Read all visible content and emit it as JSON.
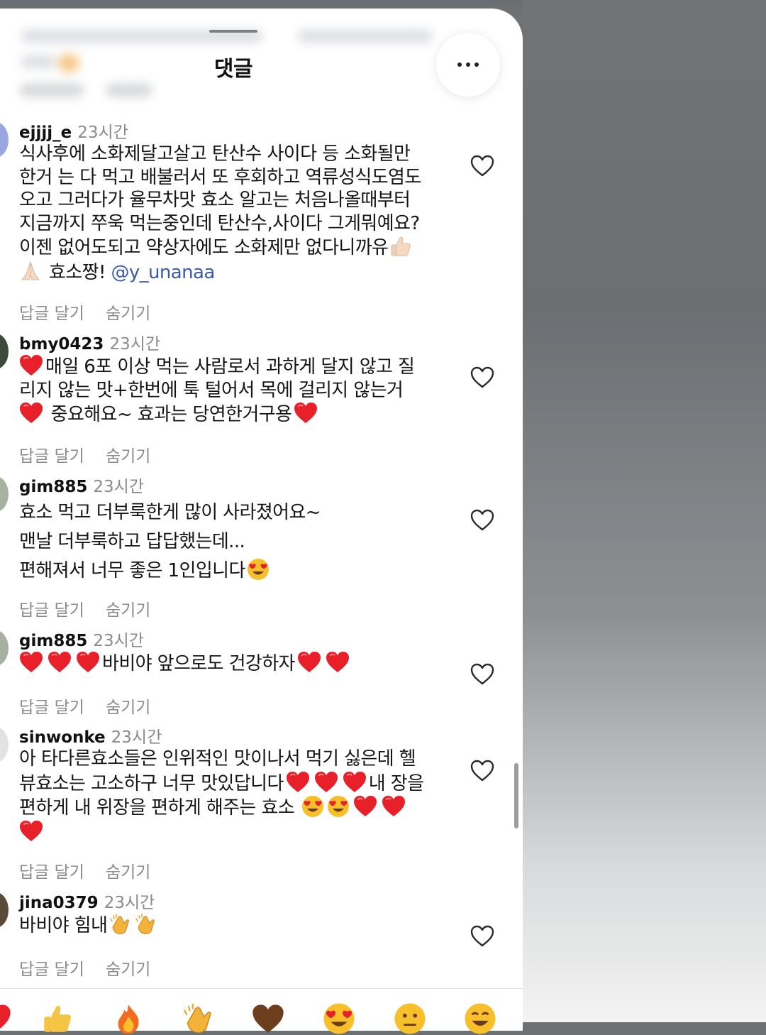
{
  "sheet": {
    "title": "댓글",
    "more_label": "더보기"
  },
  "comments": [
    {
      "user": "ejjjj_e",
      "time": "23시간",
      "lines": [
        "식사후에 소화제달고살고 탄산수 사이다 등 소화될만",
        "한거 는 다 먹고 배불러서 또 후회하고 역류성식도염도",
        "오고 그러다가 율무차맛 효소 알고는 처음나올때부터",
        "지금까지 쭈욱 먹는중인데 탄산수,사이다 그게뭐예요?",
        "이젠 없어도되고 약상자에도 소화제만 없다니까유",
        "효소짱! "
      ],
      "mention": "@y_unanaa",
      "reply_label": "답글 달기",
      "hide_label": "숨기기"
    },
    {
      "user": "bmy0423",
      "time": "23시간",
      "lines": [
        "매일 6포 이상 먹는 사람로서 과하게 달지 않고 질",
        "리지 않는 맛+한번에 툭 털어서 목에 걸리지 않는거",
        " 중요해요~ 효과는 당연한거구용"
      ],
      "reply_label": "답글 달기",
      "hide_label": "숨기기"
    },
    {
      "user": "gim885",
      "time": "23시간",
      "lines": [
        "효소 먹고 더부룩한게 많이 사라졌어요~",
        "맨날 더부룩하고 답답했는데...",
        "편해져서 너무 좋은 1인입니다"
      ],
      "reply_label": "답글 달기",
      "hide_label": "숨기기"
    },
    {
      "user": "gim885",
      "time": "23시간",
      "lines": [
        "바비야 앞으로도 건강하자"
      ],
      "reply_label": "답글 달기",
      "hide_label": "숨기기"
    },
    {
      "user": "sinwonke",
      "time": "23시간",
      "lines": [
        "아 타다른효소들은 인위적인 맛이나서 먹기 싫은데 헬",
        "뷰효소는 고소하구 너무 맛있답니다",
        "내 장을",
        "편하게 내 위장을 편하게 해주는 효소 "
      ],
      "reply_label": "답글 달기",
      "hide_label": "숨기기"
    },
    {
      "user": "jina0379",
      "time": "23시간",
      "lines": [
        "바비야 힘내"
      ],
      "reply_label": "답글 달기",
      "hide_label": "숨기기"
    }
  ],
  "reactions": [
    "thumbs-up",
    "fire",
    "clap",
    "brown-heart",
    "heart-eyes",
    "neutral-face",
    "grinning-face"
  ],
  "colors": {
    "sheet_bg": "#ffffff",
    "mention": "#3b5aa8",
    "muted_text": "#8a8a8a",
    "heart_red": "#e8202a"
  }
}
